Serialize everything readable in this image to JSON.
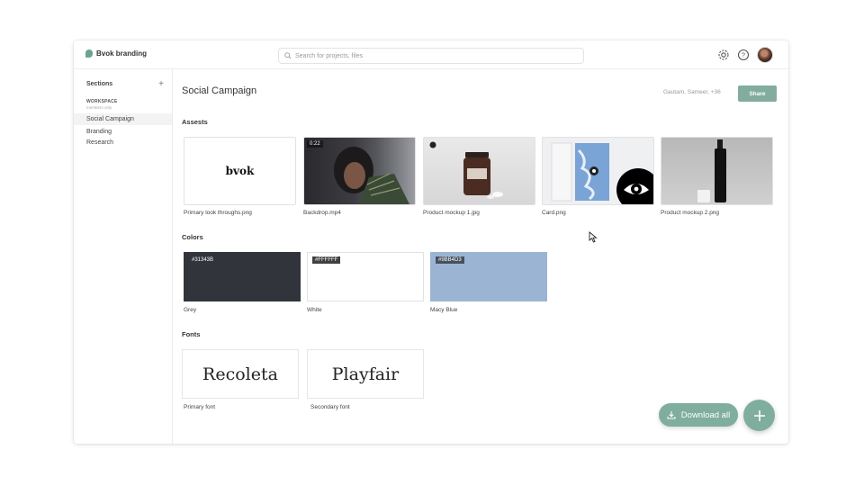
{
  "brand": {
    "name": "Bvok branding"
  },
  "search": {
    "placeholder": "Search for projects, files"
  },
  "sidebar": {
    "heading": "Sections",
    "workspace_label": "WORKSPACE",
    "workspace_sub": "members only",
    "items": [
      {
        "label": "Social Campaign",
        "active": true
      },
      {
        "label": "Branding"
      },
      {
        "label": "Research"
      }
    ]
  },
  "main": {
    "title": "Social Campaign",
    "collaborators": "Gautam, Sameer, +36",
    "share_label": "Share",
    "sections": {
      "assets": "Assests",
      "colors": "Colors",
      "fonts": "Fonts"
    },
    "assets": [
      {
        "name": "Primary look throughs.png",
        "thumb_text": "bvok"
      },
      {
        "name": "Backdrop.mp4",
        "duration": "0:22"
      },
      {
        "name": "Product mockup 1.jpg"
      },
      {
        "name": "Card.png"
      },
      {
        "name": "Product mockup 2.png"
      }
    ],
    "colors": [
      {
        "name": "Grey",
        "hex": "#31343B"
      },
      {
        "name": "White",
        "hex": "#FFFFFF"
      },
      {
        "name": "Macy Blue",
        "hex": "#9BB4D3"
      }
    ],
    "fonts": [
      {
        "name": "Primary font",
        "preview": "Recoleta"
      },
      {
        "name": "Secondary font",
        "preview": "Playfair"
      }
    ]
  },
  "actions": {
    "download_all": "Download all"
  },
  "icons": [
    "search-icon",
    "gear-icon",
    "help-icon",
    "plus-icon",
    "download-icon",
    "eye-icon",
    "cursor-icon"
  ],
  "theme": {
    "accent": "#7fae9e"
  }
}
